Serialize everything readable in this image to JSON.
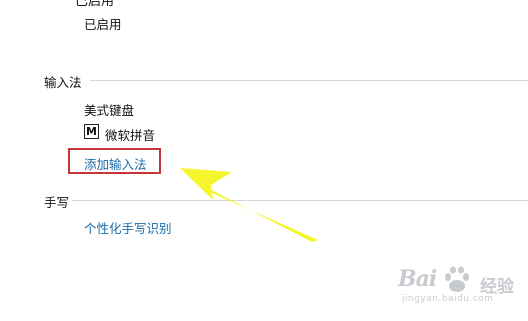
{
  "top_cut_text": "已启用",
  "enabled_status": "已启用",
  "input_method_section": {
    "title": "输入法",
    "items": [
      {
        "label": "美式键盘"
      },
      {
        "icon_text": "M",
        "label": "微软拼音"
      }
    ],
    "add_link": "添加输入法"
  },
  "handwriting_section": {
    "title": "手写",
    "link": "个性化手写识别"
  },
  "watermark": {
    "logo": "Bai",
    "brand": "经验",
    "url": "jingyan.baidu.com"
  },
  "colors": {
    "link": "#1a6aa8",
    "highlight_border": "#c5343a",
    "arrow": "#f4f52a",
    "divider": "#d6d6d6"
  }
}
